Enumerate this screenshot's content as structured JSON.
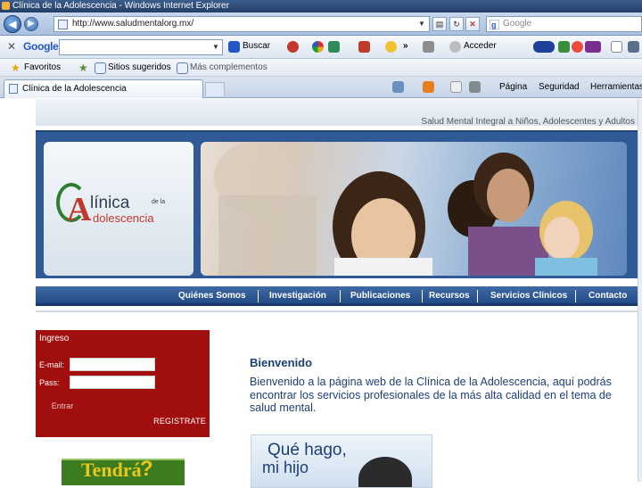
{
  "window": {
    "title": "Clínica de la Adolescencia - Windows Internet Explorer"
  },
  "address_bar": {
    "url": "http://www.saludmentalorg.mx/",
    "search_placeholder": "Google"
  },
  "google_toolbar": {
    "logo": "Google",
    "buscar_label": "Buscar",
    "acceder_label": "Acceder"
  },
  "favorites_bar": {
    "favoritos_label": "Favoritos",
    "sitios_label": "Sitios sugeridos",
    "mas_label": "Más complementos"
  },
  "tabs": [
    {
      "label": "Clínica de la Adolescencia"
    }
  ],
  "command_bar": {
    "pagina_label": "Página",
    "seguridad_label": "Seguridad",
    "herramientas_label": "Herramientas"
  },
  "site": {
    "tagline": "Salud Mental Integral a Niños, Adolescentes y Adultos",
    "logo": {
      "a": "A",
      "linica": "línica",
      "dela": "de la",
      "adolescencia": "dolescencia"
    },
    "nav": [
      {
        "label": "Quiénes Somos"
      },
      {
        "label": "Investigación"
      },
      {
        "label": "Publicaciones"
      },
      {
        "label": "Recursos"
      },
      {
        "label": "Servicios Clínicos"
      },
      {
        "label": "Contacto"
      }
    ],
    "login": {
      "title": "Ingreso",
      "email_label": "E-mail:",
      "pass_label": "Pass:",
      "button_label": "Entrar",
      "register_label": "REGISTRATE"
    },
    "welcome": {
      "title": "Bienvenido",
      "text": "Bienvenido a la página web de la Clínica de la Adolescencia, aquí podrás encontrar los servicios profesionales de la más alta calidad en el tema de salud mental."
    },
    "promo": {
      "line1": "Qué hago,",
      "line2": "mi hijo"
    },
    "green_banner": {
      "text": "Tendrá",
      "mark": "?"
    }
  }
}
